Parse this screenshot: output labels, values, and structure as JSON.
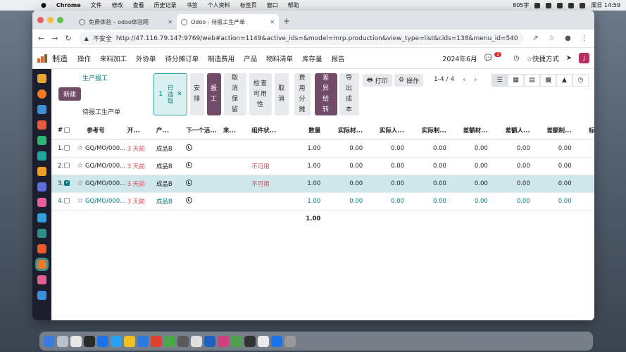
{
  "menubar": {
    "app": "Chrome",
    "items": [
      "文件",
      "修改",
      "查看",
      "历史记录",
      "书签",
      "个人资料",
      "标签页",
      "窗口",
      "帮助"
    ],
    "status": "805字",
    "clock": "周日 14:59"
  },
  "browser": {
    "tabs": [
      {
        "title": "免费体验 – odoo体验网"
      },
      {
        "title": "Odoo - 待报工生产单"
      }
    ],
    "insecure": "不安全",
    "url": "http://47.116.79.147:9769/web#action=1149&active_ids=&model=mrp.production&view_type=list&cids=138&menu_id=540"
  },
  "navbar": {
    "app": "制造",
    "menus": [
      "操作",
      "来料加工",
      "外协单",
      "待分摊订单",
      "制造费用",
      "产品",
      "物料清单",
      "库存量",
      "报告"
    ],
    "period": "2024年6月",
    "msg_count": "2",
    "shortcut": "☆快捷方式",
    "user": "J"
  },
  "control": {
    "breadcrumb": "生产报工",
    "new": "新建",
    "subtitle": "待报工生产单",
    "selected": "已选取",
    "selected_count": "1",
    "actions": [
      "安排",
      "报工",
      "取消保留",
      "检查可用性",
      "取消",
      "费用分摊",
      "差异结转",
      "导出成本"
    ],
    "print": "打印",
    "action": "操作",
    "pager": "1-4 / 4"
  },
  "table": {
    "headers": [
      "#",
      "",
      "参考号",
      "开...",
      "产...",
      "下一个活...",
      "来...",
      "组件状...",
      "数量",
      "实际材...",
      "实际人...",
      "实际制...",
      "差额材...",
      "差额人...",
      "差额制...",
      "标准"
    ],
    "rows": [
      {
        "no": "1.",
        "ref": "GQ/MO/000...",
        "start": "3 天前",
        "product": "成品B",
        "comp": "",
        "qty": "1.00",
        "v": [
          "0.00",
          "0.00",
          "0.00",
          "0.00",
          "0.00",
          "0.00"
        ]
      },
      {
        "no": "2.",
        "ref": "GQ/MO/000...",
        "start": "3 天前",
        "product": "成品B",
        "comp": "不可用",
        "qty": "1.00",
        "v": [
          "0.00",
          "0.00",
          "0.00",
          "0.00",
          "0.00",
          "0.00"
        ]
      },
      {
        "no": "3.",
        "ref": "GQ/MO/000...",
        "start": "3 天前",
        "product": "成品B",
        "comp": "不可用",
        "qty": "1.00",
        "v": [
          "0.00",
          "0.00",
          "0.00",
          "0.00",
          "0.00",
          "0.00"
        ]
      },
      {
        "no": "4.",
        "ref": "GQ/MO/000...",
        "start": "3 天前",
        "product": "成品B",
        "comp": "",
        "qty": "1.00",
        "v": [
          "0.00",
          "0.00",
          "0.00",
          "0.00",
          "0.00",
          "0.00"
        ]
      }
    ],
    "total_qty": "1.00"
  }
}
